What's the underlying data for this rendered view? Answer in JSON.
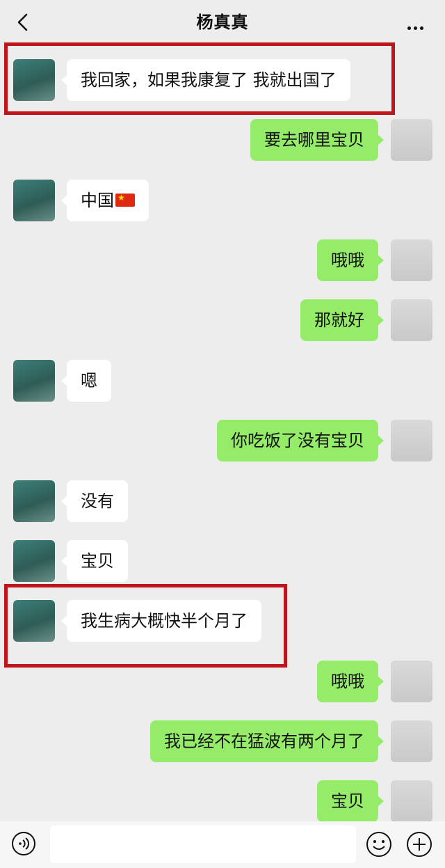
{
  "header": {
    "back_icon": "chevron-left-icon",
    "title": "杨真真",
    "more_icon": "ellipsis-icon"
  },
  "messages": [
    {
      "from": "her",
      "text": "我回家，如果我康复了 我就出国了",
      "highlighted": true
    },
    {
      "from": "me",
      "text": "要去哪里宝贝"
    },
    {
      "from": "her",
      "text": "中国",
      "emoji": "china-flag"
    },
    {
      "from": "me",
      "text": "哦哦"
    },
    {
      "from": "me",
      "text": "那就好"
    },
    {
      "from": "her",
      "text": "嗯"
    },
    {
      "from": "me",
      "text": "你吃饭了没有宝贝"
    },
    {
      "from": "her",
      "text": "没有"
    },
    {
      "from": "her",
      "text": "宝贝"
    },
    {
      "from": "her",
      "text": "我生病大概快半个月了",
      "highlighted": true
    },
    {
      "from": "me",
      "text": "哦哦"
    },
    {
      "from": "me",
      "text": "我已经不在猛波有两个月了"
    },
    {
      "from": "me",
      "text": "宝贝"
    }
  ],
  "input_bar": {
    "voice_icon": "voice-icon",
    "text_value": "",
    "emoji_icon": "emoji-icon",
    "plus_icon": "plus-icon"
  },
  "colors": {
    "background": "#ededed",
    "my_bubble": "#95ec69",
    "her_bubble": "#ffffff",
    "highlight_box": "#c0141c"
  }
}
